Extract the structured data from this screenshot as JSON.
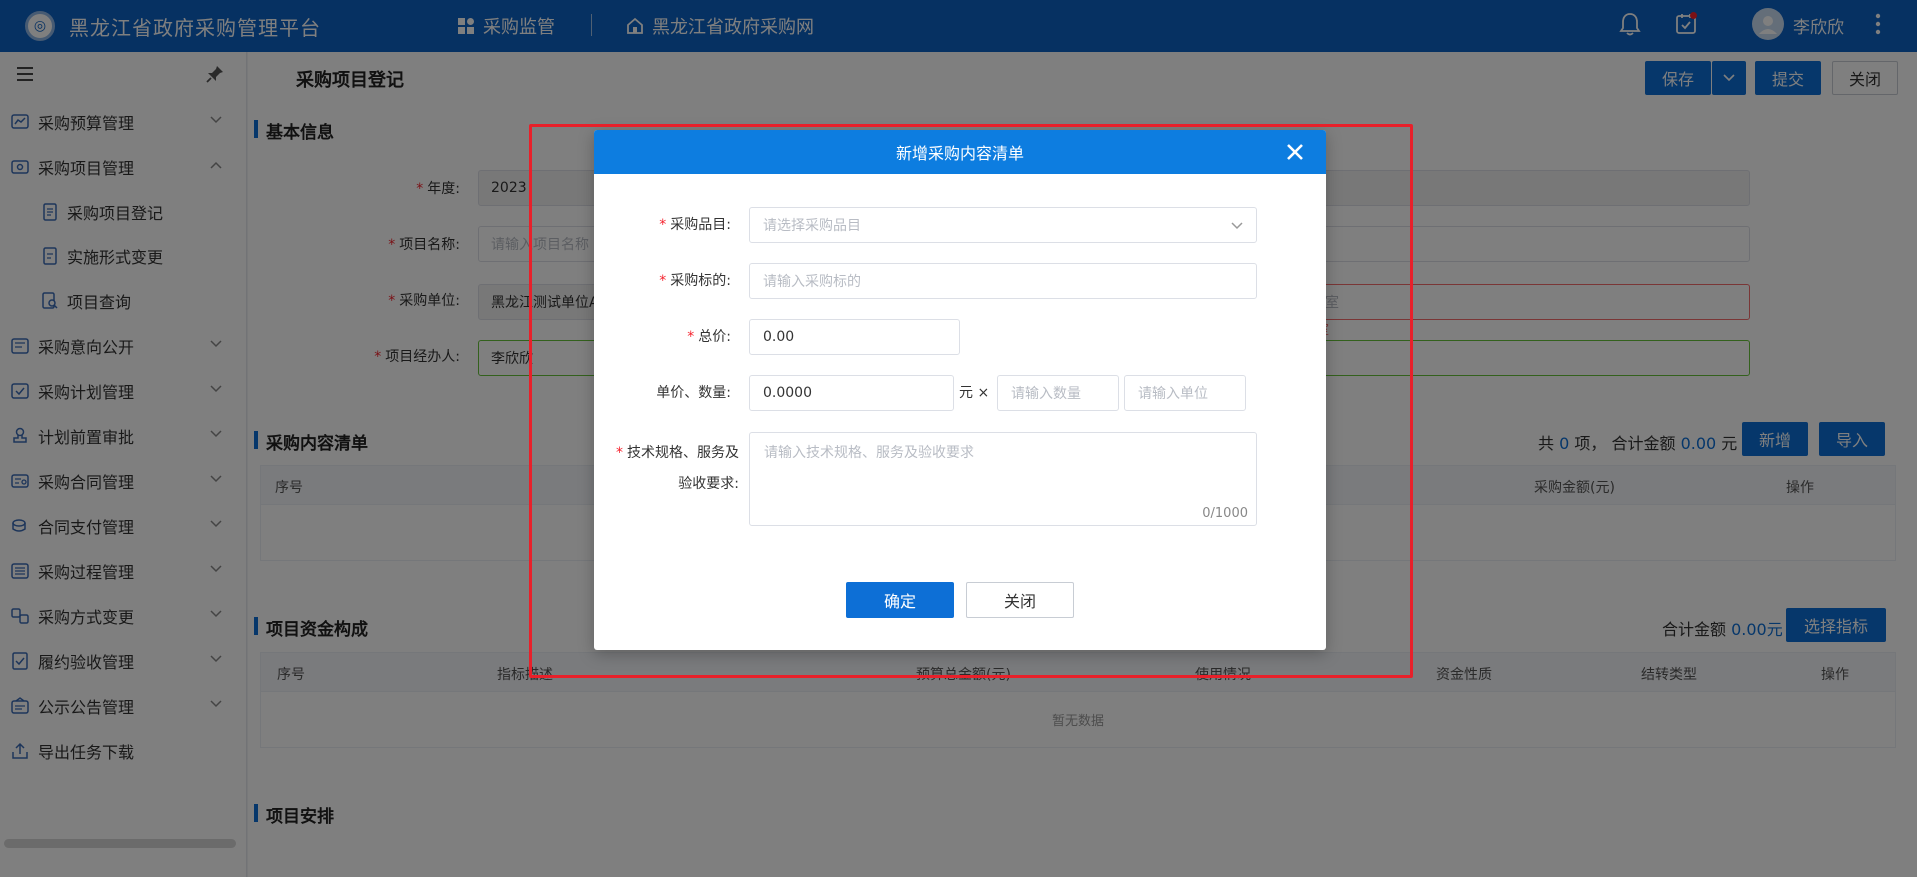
{
  "header": {
    "logo_text": "◎",
    "app_title": "黑龙江省政府采购管理平台",
    "nav": [
      "采购监管",
      "黑龙江省政府采购网"
    ],
    "user_name": "李欣欣"
  },
  "sidebar": {
    "items": [
      {
        "label": "采购预算管理"
      },
      {
        "label": "采购项目管理"
      },
      {
        "label": "采购项目登记"
      },
      {
        "label": "实施形式变更"
      },
      {
        "label": "项目查询"
      },
      {
        "label": "采购意向公开"
      },
      {
        "label": "采购计划管理"
      },
      {
        "label": "计划前置审批"
      },
      {
        "label": "采购合同管理"
      },
      {
        "label": "合同支付管理"
      },
      {
        "label": "采购过程管理"
      },
      {
        "label": "采购方式变更"
      },
      {
        "label": "履约验收管理"
      },
      {
        "label": "公示公告管理"
      },
      {
        "label": "导出任务下载"
      }
    ]
  },
  "page": {
    "title": "采购项目登记",
    "buttons": {
      "save": "保存",
      "submit": "提交",
      "close": "关闭"
    },
    "basic_info": {
      "title": "基本信息",
      "year_label": "年度:",
      "year_value": "2023",
      "project_name_label": "项目名称:",
      "project_name_placeholder": "请输入项目名称",
      "unit_label": "采购单位:",
      "unit_value": "黑龙江测试单位A",
      "unit_right_placeholder": "处室",
      "unit_error": "室",
      "manager_label": "项目经办人:",
      "manager_value": "李欣欣"
    },
    "content_list": {
      "title": "采购内容清单",
      "summary_prefix": "共",
      "count": "0",
      "summary_mid": "项，  合计金额",
      "amount": "0.00",
      "summary_suffix": "元",
      "add_button": "新增",
      "import_button": "导入",
      "columns": {
        "seq": "序号",
        "amount": "采购金额(元)",
        "op": "操作"
      }
    },
    "funds": {
      "title": "项目资金构成",
      "total_label": "合计金额",
      "total_value": "0.00元",
      "select_button": "选择指标",
      "columns": [
        "序号",
        "指标描述",
        "预算总金额(元)",
        "使用情况",
        "资金性质",
        "结转类型",
        "操作"
      ],
      "empty_text": "暂无数据"
    },
    "schedule": {
      "title": "项目安排"
    }
  },
  "dialog": {
    "title": "新增采购内容清单",
    "fields": {
      "category_label": "采购品目:",
      "category_placeholder": "请选择采购品目",
      "subject_label": "采购标的:",
      "subject_placeholder": "请输入采购标的",
      "total_label": "总价:",
      "total_value": "0.00",
      "unit_qty_label": "单价、数量:",
      "unit_price_value": "0.0000",
      "unit_text": "元 ×",
      "qty_placeholder": "请输入数量",
      "unit_placeholder": "请输入单位",
      "spec_label_1": "技术规格、服务及",
      "spec_label_2": "验收要求:",
      "spec_placeholder": "请输入技术规格、服务及验收要求",
      "spec_counter": "0/1000"
    },
    "confirm_button": "确定",
    "close_button": "关闭"
  },
  "colors": {
    "primary": "#0d6fd6",
    "header": "#0d62c4",
    "highlight": "#e8202a",
    "required": "#f5222d"
  }
}
